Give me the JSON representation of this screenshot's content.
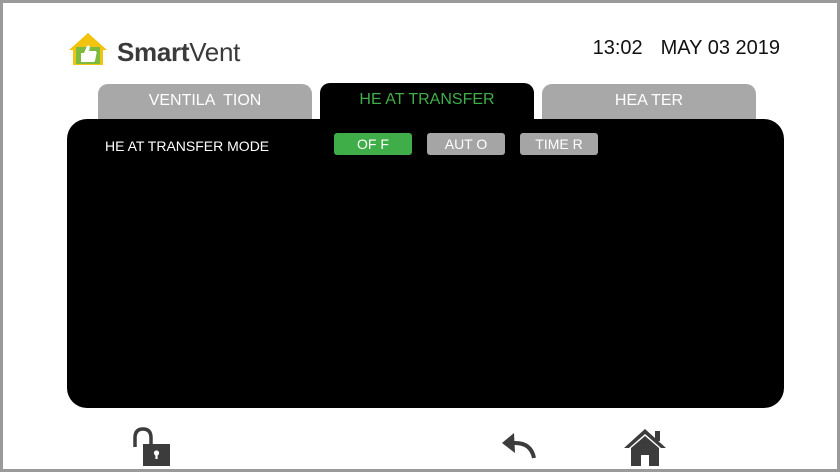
{
  "header": {
    "logo": {
      "brand_bold": "Smart",
      "brand_light": "Vent",
      "icon": "house-thumbs-up-icon"
    },
    "time": "13:02",
    "date": "MAY 03 2019"
  },
  "tabs": [
    {
      "label": "VENTILA  TION",
      "active": false
    },
    {
      "label": "HE AT TRANSFER",
      "active": true
    },
    {
      "label": "HEA TER",
      "active": false
    }
  ],
  "panel": {
    "mode_label": "HE AT TRANSFER MODE",
    "mode_options": [
      {
        "label": "OF F",
        "selected": true
      },
      {
        "label": "AUT O",
        "selected": false
      },
      {
        "label": "TIME R",
        "selected": false
      }
    ]
  },
  "footer": {
    "icons": [
      "unlock-icon",
      "back-arrow-icon",
      "home-icon"
    ]
  },
  "colors": {
    "accent_green": "#3fae49",
    "tab_inactive": "#a8a8a8",
    "button_inactive": "#a5a5a5",
    "panel_bg": "#000000",
    "icon_dark": "#3c3c3c"
  }
}
